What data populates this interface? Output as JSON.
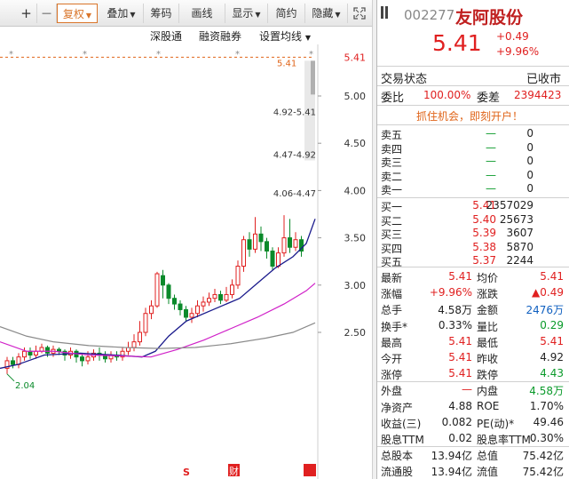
{
  "toolbar": {
    "plus": "+",
    "minus": "—",
    "adjust": "复权",
    "overlay": "叠加",
    "chips": "筹码",
    "draw": "画线",
    "display": "显示",
    "simple": "简约",
    "hide": "隐藏"
  },
  "subbar": {
    "connect": "深股通",
    "margin": "融资融券",
    "settings": "设置均线"
  },
  "chart": {
    "y_ticks": [
      "5.00",
      "4.50",
      "4.00",
      "3.50",
      "3.00",
      "2.50"
    ],
    "price_tag": "5.41",
    "last_label": "5.41",
    "chip_labels": [
      "4.92-5.41",
      "4.47-4.92",
      "4.06-4.47"
    ],
    "low_label": "2.04",
    "markers": [
      "S",
      "财"
    ],
    "colors": {
      "up": "#e02020",
      "down": "#0a8a2a",
      "ma5": "#1a1a8c",
      "ma10": "#d020c8",
      "ma20": "#8a8a8a"
    }
  },
  "stock": {
    "code": "002277",
    "name": "友阿股份",
    "price": "5.41",
    "change": "+0.49",
    "change_pct": "+9.96%",
    "status_label": "交易状态",
    "status_value": "已收市",
    "wb_label": "委比",
    "wb_value": "100.00%",
    "wc_label": "委差",
    "wc_value": "2394423",
    "promo": "抓住机会，即刻开户！"
  },
  "sells": [
    {
      "label": "卖五",
      "price": "—",
      "vol": "0"
    },
    {
      "label": "卖四",
      "price": "—",
      "vol": "0"
    },
    {
      "label": "卖三",
      "price": "—",
      "vol": "0"
    },
    {
      "label": "卖二",
      "price": "—",
      "vol": "0"
    },
    {
      "label": "卖一",
      "price": "—",
      "vol": "0"
    }
  ],
  "buys": [
    {
      "label": "买一",
      "price": "5.41",
      "vol": "2357029"
    },
    {
      "label": "买二",
      "price": "5.40",
      "vol": "25673"
    },
    {
      "label": "买三",
      "price": "5.39",
      "vol": "3607"
    },
    {
      "label": "买四",
      "price": "5.38",
      "vol": "5870"
    },
    {
      "label": "买五",
      "price": "5.37",
      "vol": "2244"
    }
  ],
  "stats": [
    {
      "l1": "最新",
      "v1": "5.41",
      "c1": "red",
      "l2": "均价",
      "v2": "5.41",
      "c2": "red"
    },
    {
      "l1": "涨幅",
      "v1": "+9.96%",
      "c1": "red",
      "l2": "涨跌",
      "v2": "▲0.49",
      "c2": "red"
    },
    {
      "l1": "总手",
      "v1": "4.58万",
      "c1": "dark",
      "l2": "金额",
      "v2": "2476万",
      "c2": "blue"
    },
    {
      "l1": "换手*",
      "v1": "0.33%",
      "c1": "dark",
      "l2": "量比",
      "v2": "0.29",
      "c2": "green"
    },
    {
      "l1": "最高",
      "v1": "5.41",
      "c1": "red",
      "l2": "最低",
      "v2": "5.41",
      "c2": "red"
    },
    {
      "l1": "今开",
      "v1": "5.41",
      "c1": "red",
      "l2": "昨收",
      "v2": "4.92",
      "c2": "dark"
    },
    {
      "l1": "涨停",
      "v1": "5.41",
      "c1": "red",
      "l2": "跌停",
      "v2": "4.43",
      "c2": "green"
    },
    {
      "l1": "外盘",
      "v1": "—",
      "c1": "red",
      "l2": "内盘",
      "v2": "4.58万",
      "c2": "green"
    },
    {
      "l1": "净资产",
      "v1": "4.88",
      "c1": "dark",
      "l2": "ROE",
      "v2": "1.70%",
      "c2": "dark"
    },
    {
      "l1": "收益(三)",
      "v1": "0.082",
      "c1": "dark",
      "l2": "PE(动)*",
      "v2": "49.46",
      "c2": "dark"
    },
    {
      "l1": "股息TTM",
      "v1": "0.02",
      "c1": "dark",
      "l2": "股息率TTM",
      "v2": "0.30%",
      "c2": "dark"
    },
    {
      "l1": "总股本",
      "v1": "13.94亿",
      "c1": "dark",
      "l2": "总值",
      "v2": "75.42亿",
      "c2": "dark"
    },
    {
      "l1": "流通股",
      "v1": "13.94亿",
      "c1": "dark",
      "l2": "流值",
      "v2": "75.42亿",
      "c2": "dark"
    }
  ]
}
